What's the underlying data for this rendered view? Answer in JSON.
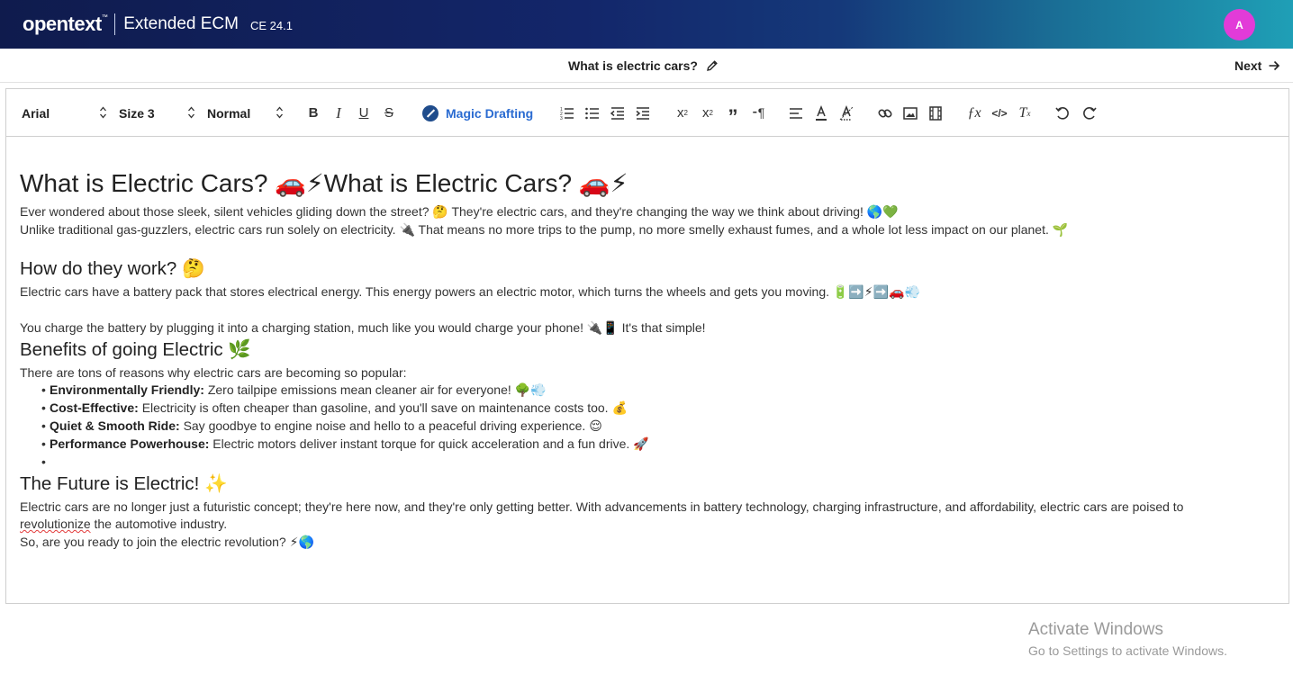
{
  "header": {
    "brand": "opentext",
    "brand_mark": "™",
    "product": "Extended ECM",
    "version": "CE 24.1",
    "avatar_initial": "A",
    "avatar_color": "#e23bd8"
  },
  "titlebar": {
    "title": "What is electric cars?",
    "next_label": "Next"
  },
  "toolbar": {
    "font": "Arial",
    "size": "Size 3",
    "style": "Normal",
    "magic_drafting": "Magic Drafting",
    "icons": [
      "bold-icon",
      "italic-icon",
      "underline-icon",
      "strikethrough-icon",
      "magic-drafting-icon",
      "ordered-list-icon",
      "bullet-list-icon",
      "outdent-icon",
      "indent-icon",
      "superscript-icon",
      "subscript-icon",
      "blockquote-icon",
      "text-direction-icon",
      "align-icon",
      "text-color-icon",
      "background-color-icon",
      "link-icon",
      "image-icon",
      "video-icon",
      "formula-icon",
      "code-block-icon",
      "clear-format-icon",
      "undo-icon",
      "redo-icon"
    ]
  },
  "content": {
    "h1": "What is Electric Cars? 🚗⚡What is Electric Cars? 🚗⚡",
    "p1": "Ever wondered about those sleek, silent vehicles gliding down the street? 🤔 They're electric cars, and they're changing the way we think about driving! 🌎💚",
    "p2": "Unlike traditional gas-guzzlers, electric cars run solely on electricity. 🔌 That means no more trips to the pump, no more smelly exhaust fumes, and a whole lot less impact on our planet. 🌱",
    "h2_work": "How do they work? 🤔",
    "p3": "Electric cars have a battery pack that stores electrical energy. This energy powers an electric motor, which turns the wheels and gets you moving. 🔋➡️⚡➡️🚗💨",
    "p4": "You charge the battery by plugging it into a charging station, much like you would charge your phone! 🔌📱 It's that simple!",
    "h2_benefits": "Benefits of going Electric 🌿",
    "p5": "There are tons of reasons why electric cars are becoming so popular:",
    "benefits": [
      {
        "title": "Environmentally Friendly:",
        "text": "Zero tailpipe emissions mean cleaner air for everyone! 🌳💨"
      },
      {
        "title": "Cost-Effective:",
        "text": "Electricity is often cheaper than gasoline, and you'll save on maintenance costs too. 💰"
      },
      {
        "title": "Quiet & Smooth Ride:",
        "text": "Say goodbye to engine noise and hello to a peaceful driving experience. 😌"
      },
      {
        "title": "Performance Powerhouse:",
        "text": "Electric motors deliver instant torque for quick acceleration and a fun drive. 🚀"
      }
    ],
    "h2_future": "The Future is Electric! ✨",
    "p6a": "Electric cars are no longer just a futuristic concept; they're here now, and they're only getting better. With advancements in battery technology, charging infrastructure, and affordability, electric cars are poised to",
    "p6b_misspelled": "revolutionize",
    "p6b_rest": " the automotive industry.",
    "p7": "So, are you ready to join the electric revolution? ⚡🌎"
  },
  "watermark": {
    "line1": "Activate Windows",
    "line2": "Go to Settings to activate Windows."
  }
}
